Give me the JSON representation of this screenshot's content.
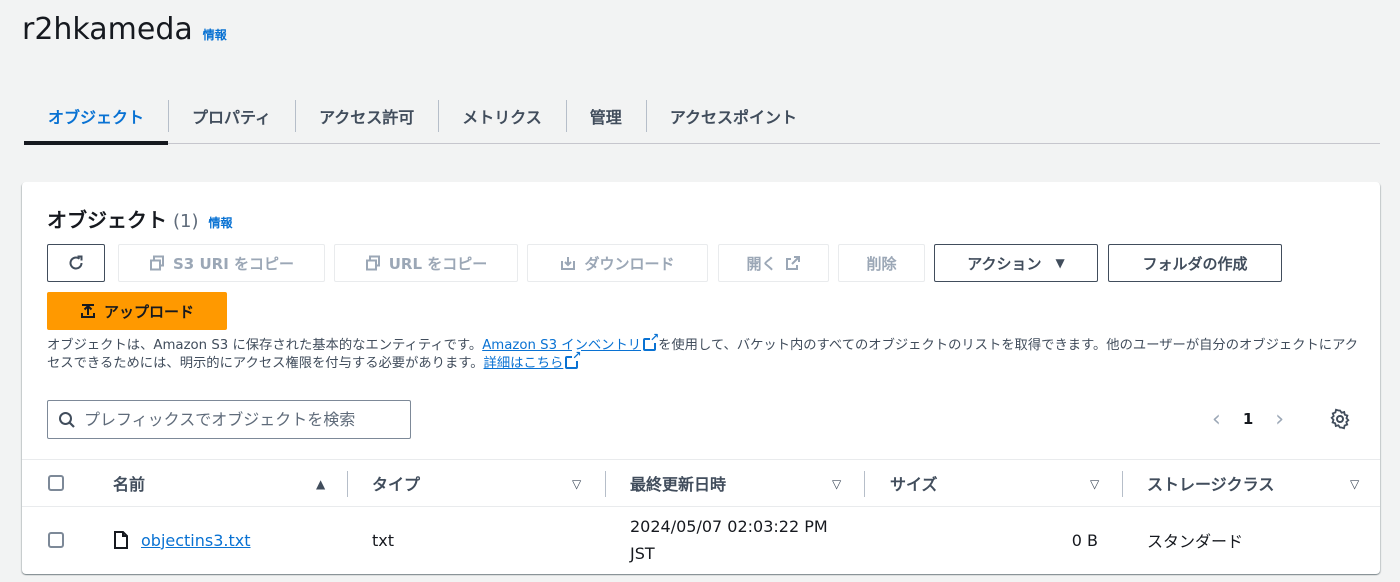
{
  "bucket": {
    "name": "r2hkameda",
    "info": "情報"
  },
  "tabs": [
    "オブジェクト",
    "プロパティ",
    "アクセス許可",
    "メトリクス",
    "管理",
    "アクセスポイント"
  ],
  "objects_panel": {
    "title": "オブジェクト",
    "count": "(1)",
    "info": "情報",
    "buttons": {
      "copy_s3_uri": "S3 URI をコピー",
      "copy_url": "URL をコピー",
      "download": "ダウンロード",
      "open": "開く",
      "delete": "削除",
      "actions": "アクション",
      "create_folder": "フォルダの作成",
      "upload": "アップロード"
    },
    "description": {
      "part1": "オブジェクトは、Amazon S3 に保存された基本的なエンティティです。",
      "inventory_link": "Amazon S3 インベントリ",
      "part2": "を使用して、バケット内のすべてのオブジェクトのリストを取得できます。他のユーザーが自分のオブジェクトにアクセスできるためには、明示的にアクセス権限を付与する必要があります。",
      "learn_more": "詳細はこちら"
    },
    "search": {
      "placeholder": "プレフィックスでオブジェクトを検索"
    },
    "pagination": {
      "current_page": "1"
    },
    "table": {
      "columns": [
        "名前",
        "タイプ",
        "最終更新日時",
        "サイズ",
        "ストレージクラス"
      ],
      "rows": [
        {
          "name": "objectins3.txt",
          "type": "txt",
          "last_modified_line1": "2024/05/07 02:03:22 PM",
          "last_modified_line2": "JST",
          "size": "0 B",
          "storage_class": "スタンダード"
        }
      ]
    }
  },
  "colors": {
    "accent": "#0972d3",
    "primary_button": "#ff9900"
  }
}
